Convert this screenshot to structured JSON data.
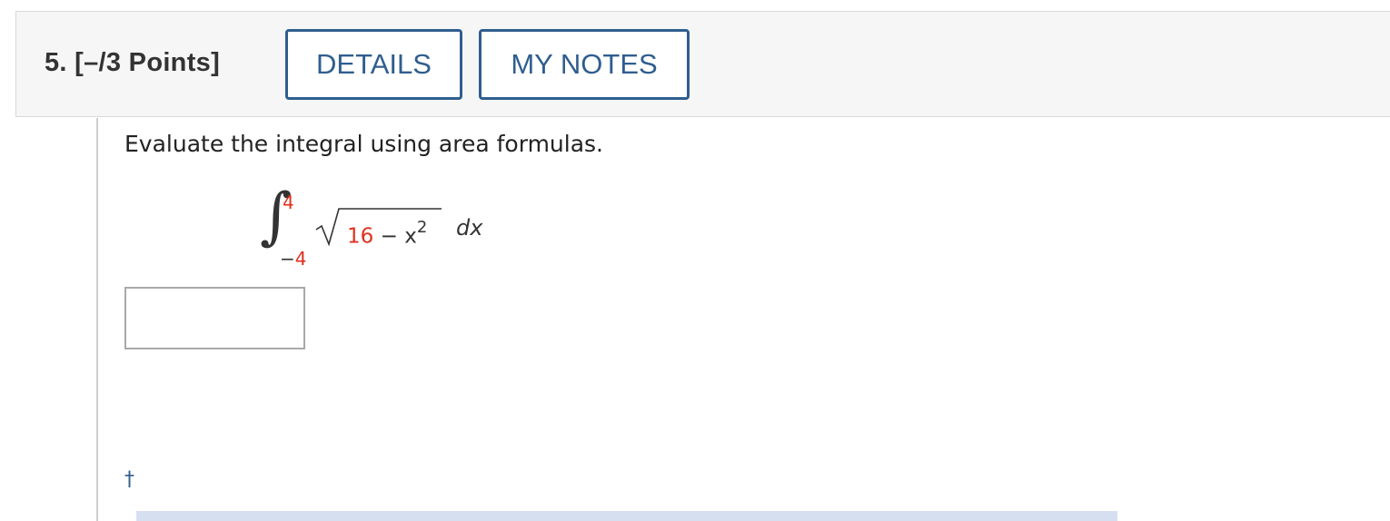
{
  "header": {
    "question_label": "5.  [–/3 Points]",
    "details_label": "DETAILS",
    "my_notes_label": "MY NOTES"
  },
  "question": {
    "prompt": "Evaluate the integral using area formulas.",
    "integral": {
      "upper_limit": "4",
      "lower_sign": "−",
      "lower_limit": "4",
      "radicand_constant": "16",
      "radicand_operator": "−",
      "radicand_variable": "x",
      "radicand_exponent": "2",
      "differential": "dx"
    },
    "answer_value": "",
    "footnote_marker": "†"
  },
  "colors": {
    "accent": "#2f5e8f",
    "highlight_red": "#e0301e",
    "header_bg": "#f6f6f6",
    "footer_bar": "#d6dff0"
  }
}
